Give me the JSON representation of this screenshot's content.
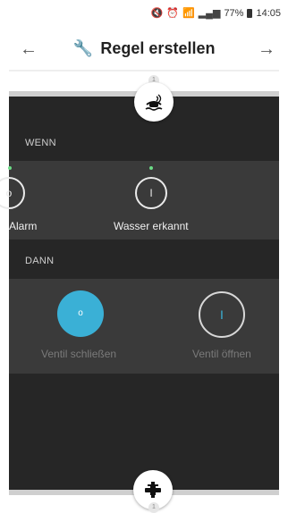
{
  "status_bar": {
    "battery": "77%",
    "time": "14:05",
    "icons": [
      "mute-icon",
      "alarm-icon",
      "wifi-icon",
      "signal-icon",
      "battery-icon"
    ]
  },
  "app_bar": {
    "title": "Regel erstellen",
    "back_icon": "arrow-left-icon",
    "forward_icon": "arrow-right-icon",
    "title_icon": "wrench-icon"
  },
  "steps": {
    "top": "1",
    "bottom": "1"
  },
  "sections": {
    "wenn": "WENN",
    "dann": "DANN"
  },
  "conditions": [
    {
      "label": "Alarm"
    },
    {
      "label": "Wasser erkannt"
    }
  ],
  "actions": [
    {
      "label": "Ventil schließen"
    },
    {
      "label": "Ventil öffnen"
    }
  ],
  "colors": {
    "accent": "#3ab0d6",
    "panel": "#262626",
    "row": "#3a3a3a",
    "indicator": "#6bdc86"
  }
}
